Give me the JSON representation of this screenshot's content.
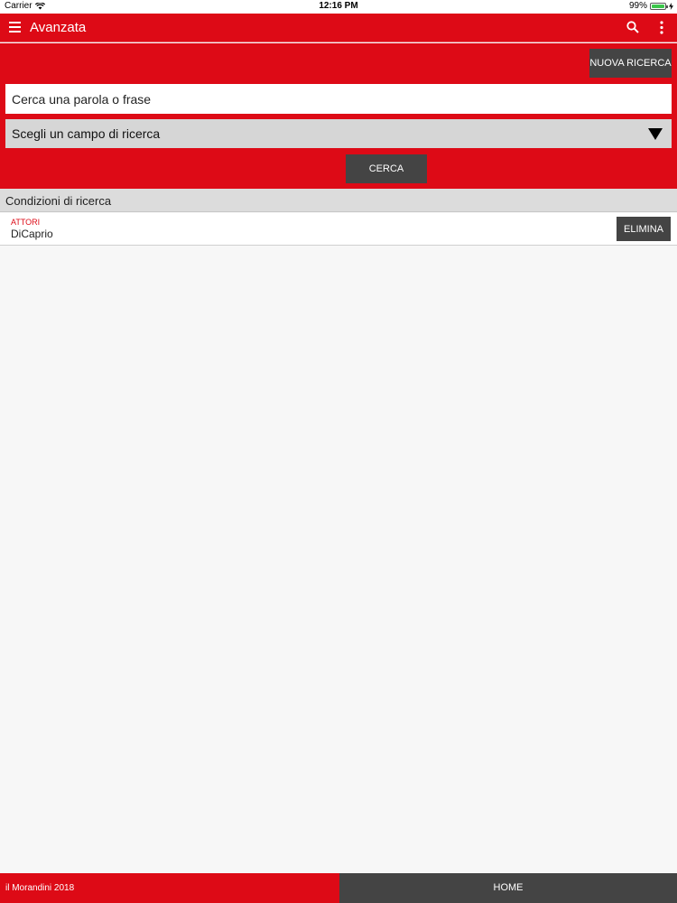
{
  "status_bar": {
    "carrier": "Carrier",
    "time": "12:16 PM",
    "battery": "99%",
    "battery_level": 0.99,
    "wifi_icon": "wifi-icon",
    "battery_icon": "battery-icon"
  },
  "app_bar": {
    "title": "Avanzata",
    "menu_icon": "hamburger-menu-icon",
    "search_icon": "search-icon",
    "more_icon": "more-vertical-icon"
  },
  "search": {
    "new_search_label": "NUOVA RICERCA",
    "input_placeholder": "Cerca una parola o frase",
    "input_value": "",
    "field_select_label": "Scegli un campo di ricerca",
    "submit_label": "CERCA"
  },
  "conditions": {
    "header": "Condizioni di ricerca",
    "items": [
      {
        "field": "ATTORI",
        "value": "DiCaprio",
        "delete_label": "ELIMINA"
      }
    ]
  },
  "footer": {
    "copyright": "il Morandini 2018",
    "home_label": "HOME"
  },
  "colors": {
    "accent_red": "#dd0a16",
    "dark_button": "#444444",
    "background": "#f7f7f7"
  }
}
